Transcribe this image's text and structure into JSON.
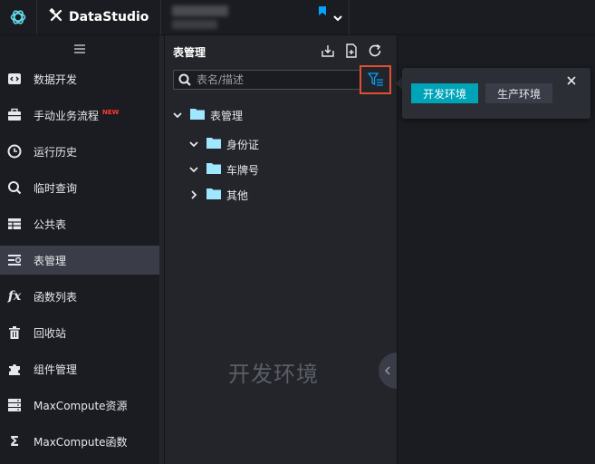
{
  "app": {
    "brand": "DataStudio"
  },
  "sidebar": {
    "items": [
      {
        "label": "数据开发",
        "icon": "code-icon"
      },
      {
        "label": "手动业务流程",
        "icon": "briefcase-icon",
        "badge": "NEW"
      },
      {
        "label": "运行历史",
        "icon": "clock-icon"
      },
      {
        "label": "临时查询",
        "icon": "search-icon"
      },
      {
        "label": "公共表",
        "icon": "table-icon"
      },
      {
        "label": "表管理",
        "icon": "table-manage-icon",
        "active": true
      },
      {
        "label": "函数列表",
        "icon": "function-icon"
      },
      {
        "label": "回收站",
        "icon": "trash-icon"
      },
      {
        "label": "组件管理",
        "icon": "puzzle-icon"
      },
      {
        "label": "MaxCompute资源",
        "icon": "resource-icon"
      },
      {
        "label": "MaxCompute函数",
        "icon": "sigma-icon"
      }
    ]
  },
  "panel": {
    "title": "表管理",
    "search_placeholder": "表名/描述",
    "tree": [
      {
        "label": "表管理",
        "expanded": true,
        "level": 0
      },
      {
        "label": "身份证",
        "expanded": true,
        "level": 1
      },
      {
        "label": "车牌号",
        "expanded": true,
        "level": 1
      },
      {
        "label": "其他",
        "expanded": false,
        "level": 1
      }
    ],
    "watermark": "开发环境"
  },
  "popover": {
    "dev_label": "开发环境",
    "prod_label": "生产环境"
  },
  "colors": {
    "accent": "#00a4b8",
    "folder": "#9fe6ff",
    "highlight": "#e0502e"
  }
}
